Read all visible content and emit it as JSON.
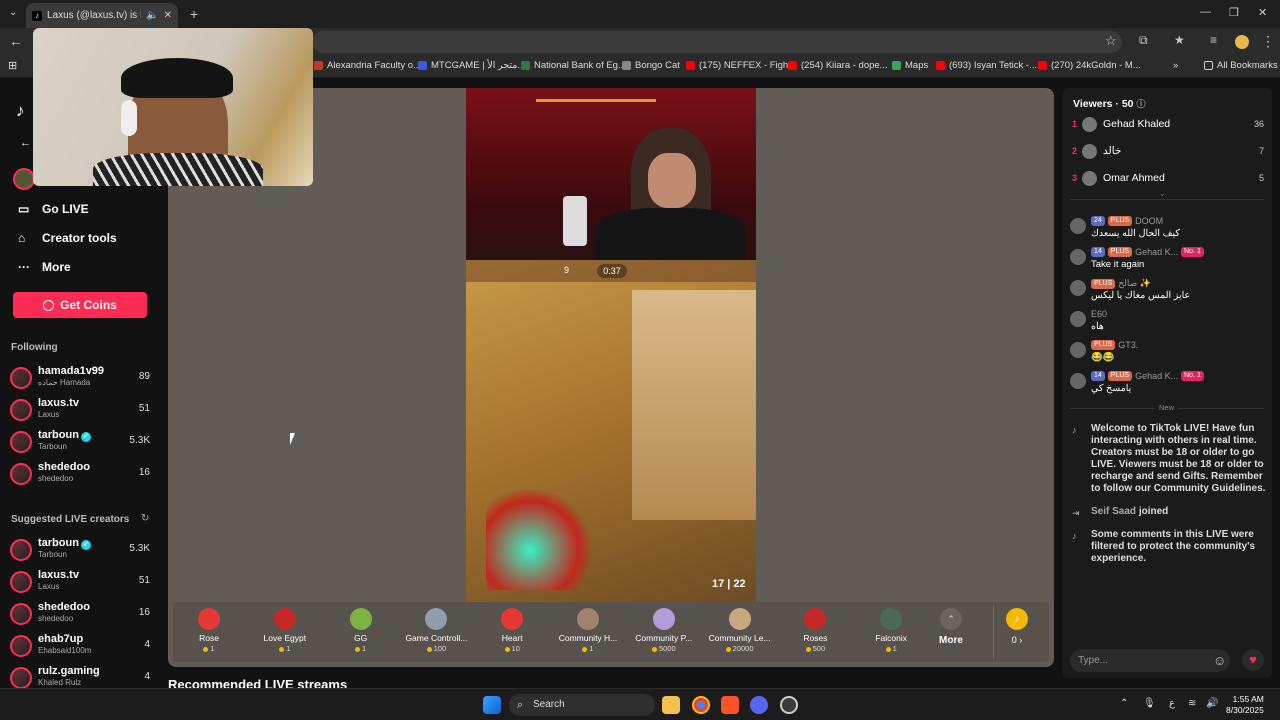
{
  "browser": {
    "tab_title": "Laxus (@laxus.tv) is LIVE - T",
    "new_tab": "+",
    "bookmarks": [
      {
        "label": "Alexandria Faculty o...",
        "color": "#c0392b"
      },
      {
        "label": "MTCGAME | متجر الأ...",
        "color": "#3b5bdb"
      },
      {
        "label": "National Bank of Eg...",
        "color": "#2e7d32"
      },
      {
        "label": "Bongo Cat",
        "color": "#888888"
      },
      {
        "label": "(175) NEFFEX - Figh...",
        "color": "#ff0000"
      },
      {
        "label": "(254) Kiiara - dope...",
        "color": "#ff0000"
      },
      {
        "label": "Maps",
        "color": "#34a853"
      },
      {
        "label": "(693) Isyan Tetick -...",
        "color": "#ff0000"
      },
      {
        "label": "(270) 24kGoldn - M...",
        "color": "#ff0000"
      }
    ],
    "all_bookmarks": "All Bookmarks"
  },
  "sidebar": {
    "nav": [
      {
        "label": "Go LIVE",
        "icon": "video-icon"
      },
      {
        "label": "Creator tools",
        "icon": "home-icon"
      },
      {
        "label": "More",
        "icon": "more-icon"
      }
    ],
    "get_coins": "Get Coins",
    "following_title": "Following",
    "following": [
      {
        "name": "hamada1v99",
        "sub": "حماده Hamada",
        "count": "89"
      },
      {
        "name": "laxus.tv",
        "sub": "Laxus",
        "count": "51"
      },
      {
        "name": "tarboun",
        "sub": "Tarboun",
        "count": "5.3K",
        "verified": true
      },
      {
        "name": "shededoo",
        "sub": "shededoo",
        "count": "16"
      }
    ],
    "suggested_title": "Suggested LIVE creators",
    "suggested": [
      {
        "name": "tarboun",
        "sub": "Tarboun",
        "count": "5.3K",
        "verified": true
      },
      {
        "name": "laxus.tv",
        "sub": "Laxus",
        "count": "51"
      },
      {
        "name": "shededoo",
        "sub": "shededoo",
        "count": "16"
      },
      {
        "name": "ehab7up",
        "sub": "Ehabsaid100m",
        "count": "4"
      },
      {
        "name": "rulz.gaming",
        "sub": "Khaled Rulz",
        "count": "4"
      }
    ]
  },
  "stream": {
    "timer": "0:37",
    "ammo": "17 | 22",
    "hud_left": "9"
  },
  "gifts": [
    {
      "name": "Rose",
      "price": "1",
      "color": "#e53935"
    },
    {
      "name": "Love Egypt",
      "price": "1",
      "color": "#c62828"
    },
    {
      "name": "GG",
      "price": "1",
      "color": "#7cb342"
    },
    {
      "name": "Game Controll...",
      "price": "100",
      "color": "#8e9eab"
    },
    {
      "name": "Heart",
      "price": "10",
      "color": "#e53935"
    },
    {
      "name": "Community H...",
      "price": "1",
      "color": "#a0826d"
    },
    {
      "name": "Community P...",
      "price": "5000",
      "color": "#b39ddb"
    },
    {
      "name": "Community Le...",
      "price": "20000",
      "color": "#c8a97e"
    },
    {
      "name": "Roses",
      "price": "500",
      "color": "#c62828"
    },
    {
      "name": "Falconix",
      "price": "1",
      "color": "#4a6b5a"
    }
  ],
  "gift_more": "More",
  "coin_balance": "0",
  "recommended_title": "Recommended LIVE streams",
  "viewers": {
    "title": "Viewers · 50",
    "list": [
      {
        "rank": "1",
        "name": "Gehad Khaled",
        "score": "36"
      },
      {
        "rank": "2",
        "name": "خالد",
        "score": "7"
      },
      {
        "rank": "3",
        "name": "Omar Ahmed",
        "score": "5"
      }
    ]
  },
  "chat": [
    {
      "lvl": "24",
      "plus": "PLUS",
      "name": "DOOM",
      "text": "كيف الحال الله يسعدك",
      "no1": ""
    },
    {
      "lvl": "14",
      "plus": "PLUS",
      "name": "Gehad K...",
      "text": "Take it again",
      "no1": "No. 1"
    },
    {
      "lvl": "",
      "plus": "PLUS",
      "name": "صالح ✨",
      "text": "عايز المس معاك يا ليكس",
      "no1": ""
    },
    {
      "lvl": "",
      "plus": "",
      "name": "E60",
      "text": "هاه",
      "no1": ""
    },
    {
      "lvl": "",
      "plus": "PLUS",
      "name": "GT3.",
      "text": "😂😂",
      "no1": ""
    },
    {
      "lvl": "14",
      "plus": "PLUS",
      "name": "Gehad K...",
      "text": "يامسخ كي",
      "no1": "No. 1"
    }
  ],
  "new_label": "New",
  "system_messages": {
    "welcome": "Welcome to TikTok LIVE! Have fun interacting with others in real time. Creators must be 18 or older to go LIVE. Viewers must be 18 or older to recharge and send Gifts. Remember to follow our Community Guidelines.",
    "joined_name": "Seif Saad",
    "joined": "joined",
    "filtered": "Some comments in this LIVE were filtered to protect the community's experience."
  },
  "chat_input_placeholder": "Type...",
  "taskbar": {
    "search": "Search",
    "time": "1:55 AM",
    "date": "8/30/2025",
    "lang": "ع"
  }
}
